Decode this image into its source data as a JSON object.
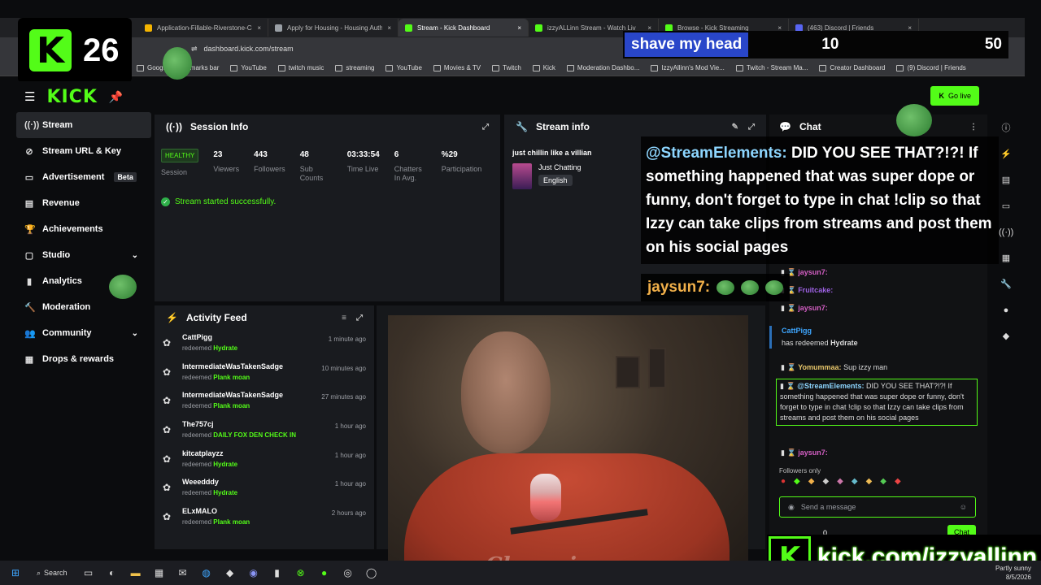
{
  "overlay": {
    "badge_count": "26",
    "goal_title": "shave my head",
    "goal_current": "10",
    "goal_max": "50",
    "kick_url": "kick.com/izzyallinn"
  },
  "browser": {
    "tabs": [
      {
        "label": "Application-Fillable-Riverstone-Co",
        "color": "#f4b400"
      },
      {
        "label": "Apply for Housing - Housing Auth",
        "color": "#9aa0a6"
      },
      {
        "label": "Stream - Kick Dashboard",
        "color": "#53fc18",
        "active": true
      },
      {
        "label": "izzyALLinn Stream - Watch Liv",
        "color": "#53fc18"
      },
      {
        "label": "Browse - Kick Streaming",
        "color": "#53fc18"
      },
      {
        "label": "(463) Discord | Friends",
        "color": "#5865f2"
      }
    ],
    "url": "dashboard.kick.com/stream",
    "bookmarks": [
      "Google",
      "marks bar",
      "YouTube",
      "twitch music",
      "streaming",
      "YouTube",
      "Movies & TV",
      "Twitch",
      "Kick",
      "Moderation Dashbo...",
      "IzzyAllinn's Mod Vie...",
      "Twitch - Stream Ma...",
      "Creator Dashboard",
      "(9) Discord | Friends"
    ]
  },
  "dash": {
    "go_live": "Go live"
  },
  "sidebar": {
    "items": [
      {
        "label": "Stream",
        "icon": "((·))"
      },
      {
        "label": "Stream URL & Key",
        "icon": "⊘"
      },
      {
        "label": "Advertisement",
        "icon": "▭",
        "badge": "Beta"
      },
      {
        "label": "Revenue",
        "icon": "▤"
      },
      {
        "label": "Achievements",
        "icon": "🏆"
      },
      {
        "label": "Studio",
        "icon": "▢",
        "chevron": true
      },
      {
        "label": "Analytics",
        "icon": "▮"
      },
      {
        "label": "Moderation",
        "icon": "🔨"
      },
      {
        "label": "Community",
        "icon": "👥",
        "chevron": true
      },
      {
        "label": "Drops & rewards",
        "icon": "▦"
      }
    ]
  },
  "session": {
    "title": "Session Info",
    "healthy": "HEALTHY",
    "session_label": "Session",
    "stats": [
      {
        "value": "23",
        "label": "Viewers"
      },
      {
        "value": "443",
        "label": "Followers"
      },
      {
        "value": "48",
        "label": "Sub Counts"
      },
      {
        "value": "03:33:54",
        "label": "Time Live"
      },
      {
        "value": "6",
        "label": "Chatters In Avg."
      },
      {
        "value": "%29",
        "label": "Participation"
      }
    ],
    "started": "Stream started successfully."
  },
  "streaminfo": {
    "title": "Stream info",
    "stream_title": "just chillin like a villian",
    "category": "Just Chatting",
    "language": "English"
  },
  "activity": {
    "title": "Activity Feed",
    "items": [
      {
        "name": "CattPigg",
        "action": "redeemed",
        "reward": "Hydrate",
        "time": "1 minute ago"
      },
      {
        "name": "IntermediateWasTakenSadge",
        "action": "redeemed",
        "reward": "Plank moan",
        "time": "10 minutes ago"
      },
      {
        "name": "IntermediateWasTakenSadge",
        "action": "redeemed",
        "reward": "Plank moan",
        "time": "27 minutes ago"
      },
      {
        "name": "The757cj",
        "action": "redeemed",
        "reward": "DAILY FOX DEN CHECK IN",
        "time": "1 hour ago"
      },
      {
        "name": "kitcatplayzz",
        "action": "redeemed",
        "reward": "Hydrate",
        "time": "1 hour ago"
      },
      {
        "name": "Weeedddy",
        "action": "redeemed",
        "reward": "Hydrate",
        "time": "1 hour ago"
      },
      {
        "name": "ELxMALO",
        "action": "redeemed",
        "reward": "Plank moan",
        "time": "2 hours ago"
      }
    ]
  },
  "chat": {
    "title": "Chat",
    "overlay_user": "@StreamElements:",
    "overlay_msg": "DID YOU SEE THAT?!?! If something happened that was super dope or funny, don't forget to type in chat !clip so that Izzy can take clips from streams and post them on his social pages",
    "overlay_user2": "jaysun7:",
    "redeem_user": "CattPigg",
    "redeem_text": "has redeemed",
    "redeem_reward": "Hydrate",
    "msg1_user": "Yomummaa:",
    "msg1_text": "Sup izzy man",
    "msg2_user": "@StreamElements:",
    "msg2_text": "DID YOU SEE THAT?!?! If something happened that was super dope or funny, don't forget to type in chat !clip so that Izzy can take clips from streams and post them on his social pages",
    "msg3_user": "jaysun7:",
    "msg_user_a": "jaysun7:",
    "msg_user_b": "Fruitcake:",
    "msg_user_c": "jaysun7:",
    "followers_only": "Followers only",
    "placeholder": "Send a message",
    "points": "0",
    "send": "Chat"
  },
  "taskbar": {
    "search": "Search",
    "weather": "Partly sunny",
    "date": "8/5/2026"
  }
}
